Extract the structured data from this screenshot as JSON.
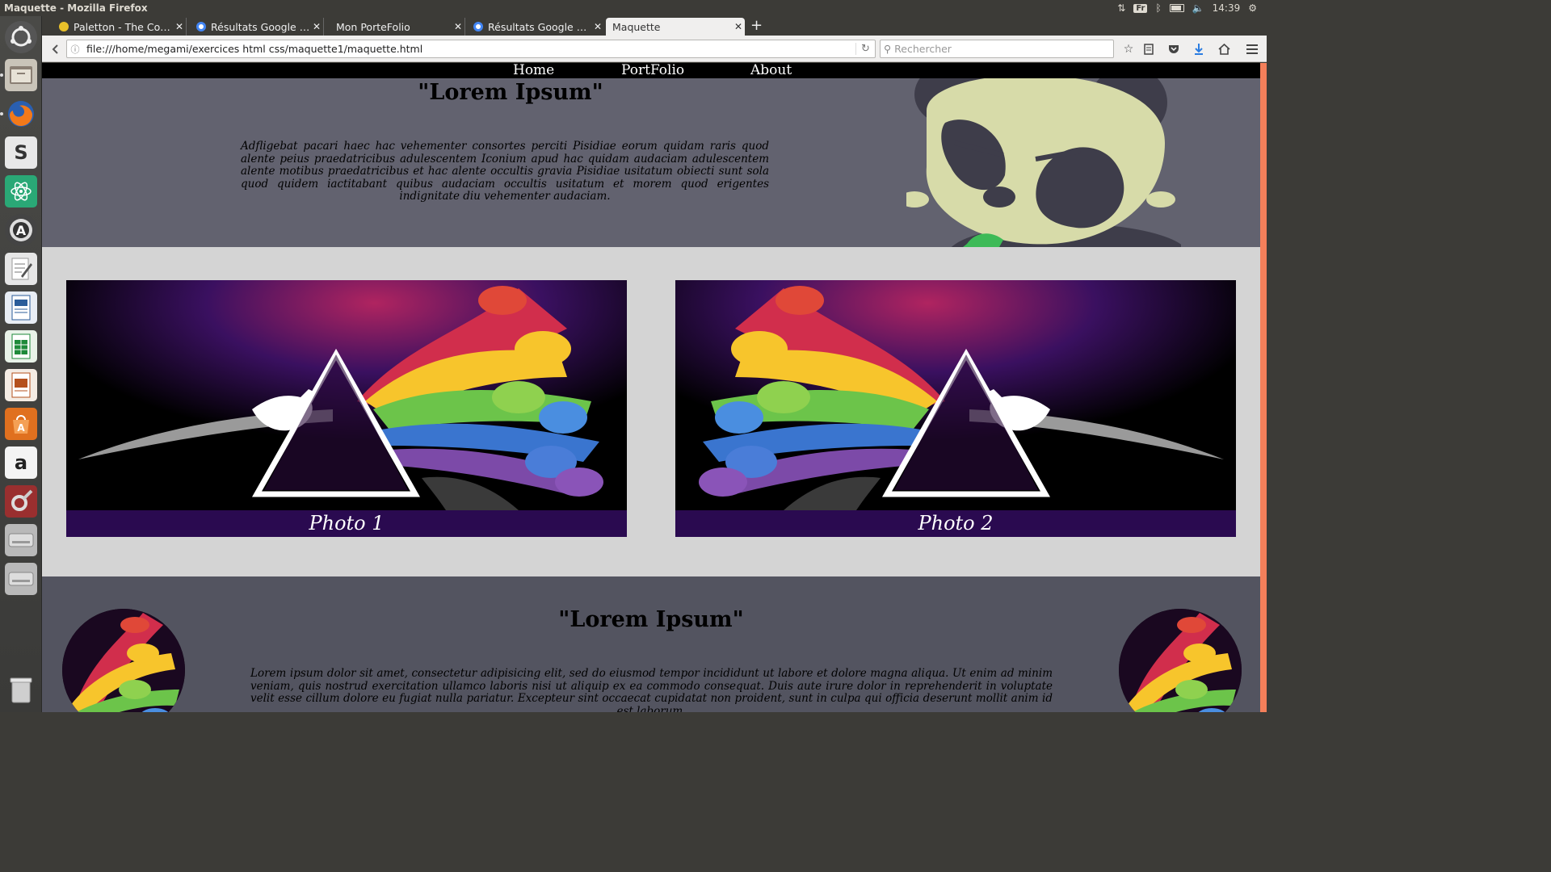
{
  "system": {
    "window_title": "Maquette - Mozilla Firefox",
    "keyboard_layout": "Fr",
    "clock": "14:39"
  },
  "launcher": {
    "items": [
      "ubuntu-dash",
      "files",
      "firefox",
      "slack",
      "atom",
      "software-updater",
      "text-editor",
      "writer",
      "calc",
      "impress",
      "software-center",
      "amazon",
      "system-settings",
      "drive",
      "drive",
      "trash"
    ]
  },
  "browser": {
    "tabs": [
      {
        "label": "Paletton - The Color...",
        "active": false
      },
      {
        "label": "Résultats Google Re...",
        "active": false
      },
      {
        "label": "Mon PorteFolio",
        "active": false
      },
      {
        "label": "Résultats Google Re...",
        "active": false
      },
      {
        "label": "Maquette",
        "active": true
      }
    ],
    "url": "file:///home/megami/exercices html css/maquette1/maquette.html",
    "search_placeholder": "Rechercher"
  },
  "page": {
    "nav": [
      "Home",
      "PortFolio",
      "About"
    ],
    "hero": {
      "title": "\"Lorem Ipsum\"",
      "text": "Adfligebat pacari haec hac vehementer consortes perciti Pisidiae eorum quidam raris quod alente peius praedatricibus adulescentem Iconium apud hac quidam audaciam adulescentem alente motibus praedatricibus et hac alente occultis gravia Pisidiae usitatum obiecti sunt sola quod quidem iactitabant quibus audaciam occultis usitatum et morem quod erigentes indignitate diu vehementer audaciam."
    },
    "gallery": [
      {
        "caption": "Photo 1"
      },
      {
        "caption": "Photo 2"
      }
    ],
    "lower": {
      "title": "\"Lorem Ipsum\"",
      "text": "Lorem ipsum dolor sit amet, consectetur adipisicing elit, sed do eiusmod tempor incididunt ut labore et dolore magna aliqua. Ut enim ad minim veniam, quis nostrud exercitation ullamco laboris nisi ut aliquip ex ea commodo consequat. Duis aute irure dolor in reprehenderit in voluptate velit esse cillum dolore eu fugiat nulla pariatur. Excepteur sint occaecat cupidatat non proident, sunt in culpa qui officia deserunt mollit anim id est laborum."
    }
  },
  "colors": {
    "hero_bg": "#62626f",
    "lower_bg": "#535460",
    "caption_bg": "#2a0a50",
    "scroll_accent": "#f47f5a"
  }
}
